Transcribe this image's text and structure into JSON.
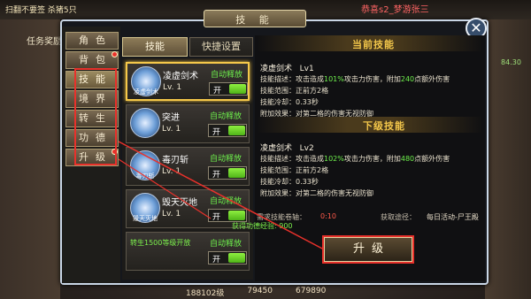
{
  "topbar": {
    "left_text": "扫翻不要签 杀猪5只",
    "announce": "恭喜s2_梦游张三 ",
    "mission": "任务奖励",
    "right_score": "84.30"
  },
  "dialog": {
    "title": "技 能",
    "close_icon": "close-icon"
  },
  "categories": [
    {
      "label": "角色",
      "active": false,
      "badge": false
    },
    {
      "label": "背包",
      "active": false,
      "badge": true
    },
    {
      "label": "技能",
      "active": true,
      "badge": false
    },
    {
      "label": "境界",
      "active": false,
      "badge": false
    },
    {
      "label": "转生",
      "active": false,
      "badge": false
    },
    {
      "label": "功德",
      "active": false,
      "badge": false
    },
    {
      "label": "升级",
      "active": false,
      "badge": true
    }
  ],
  "tabs": {
    "skill": "技能",
    "quick": "快捷设置"
  },
  "skills": [
    {
      "name": "凌虚剑术",
      "icon_label": "凌虚剑术",
      "level": "Lv. 1",
      "auto": "自动释放",
      "toggle": "开",
      "selected": true
    },
    {
      "name": "突进",
      "icon_label": "",
      "level": "Lv. 1",
      "auto": "自动释放",
      "toggle": "开",
      "selected": false
    },
    {
      "name": "毒刃斩",
      "icon_label": "毒刃斩",
      "level": "Lv. 1",
      "auto": "自动释放",
      "toggle": "开",
      "selected": false
    },
    {
      "name": "毁天灭地",
      "icon_label": "毁天灭地",
      "level": "Lv. 1",
      "auto": "自动释放",
      "toggle": "开",
      "selected": false
    },
    {
      "name": "",
      "icon_label": "",
      "level": "",
      "auto": "自动释放",
      "toggle": "开",
      "selected": false,
      "unlock": "转生1500等级开放"
    }
  ],
  "current": {
    "section_title": "当前技能",
    "name": "凌虚剑术",
    "level": "Lv1",
    "desc_label": "技能描述：",
    "desc_pre": "攻击造成",
    "desc_pct": "101%",
    "desc_mid": "攻击力伤害，附加",
    "desc_add": "240",
    "desc_post": "点额外伤害",
    "range_label": "技能范围：",
    "range": "正前方2格",
    "cd_label": "技能冷却：",
    "cd": "0.33秒",
    "effect_label": "附加效果：",
    "effect": "对第二格的伤害无视防御"
  },
  "next": {
    "section_title": "下级技能",
    "name": "凌虚剑术",
    "level": "Lv2",
    "desc_label": "技能描述：",
    "desc_pre": "攻击造成",
    "desc_pct": "102%",
    "desc_mid": "攻击力伤害，附加",
    "desc_add": "480",
    "desc_post": "点额外伤害",
    "range_label": "技能范围：",
    "range": "正前方2格",
    "cd_label": "技能冷却：",
    "cd": "0.33秒",
    "effect_label": "附加效果：",
    "effect": "对第二格的伤害无视防御"
  },
  "requirement": {
    "label": "需求技能卷轴：",
    "value": "0:10",
    "source_label": "获取途径：",
    "source_value": "每日活动-尸王殿",
    "gain_exp": "获得功德经验: 900"
  },
  "upgrade_button": "升级",
  "bottom": {
    "item1": "188102级",
    "item2": "79450",
    "item3": "679890"
  },
  "colors": {
    "highlight_green": "#6ef04c",
    "highlight_red": "#ff5a4a",
    "gold_title": "#f2c64a",
    "annotation_red": "#e8312b"
  }
}
